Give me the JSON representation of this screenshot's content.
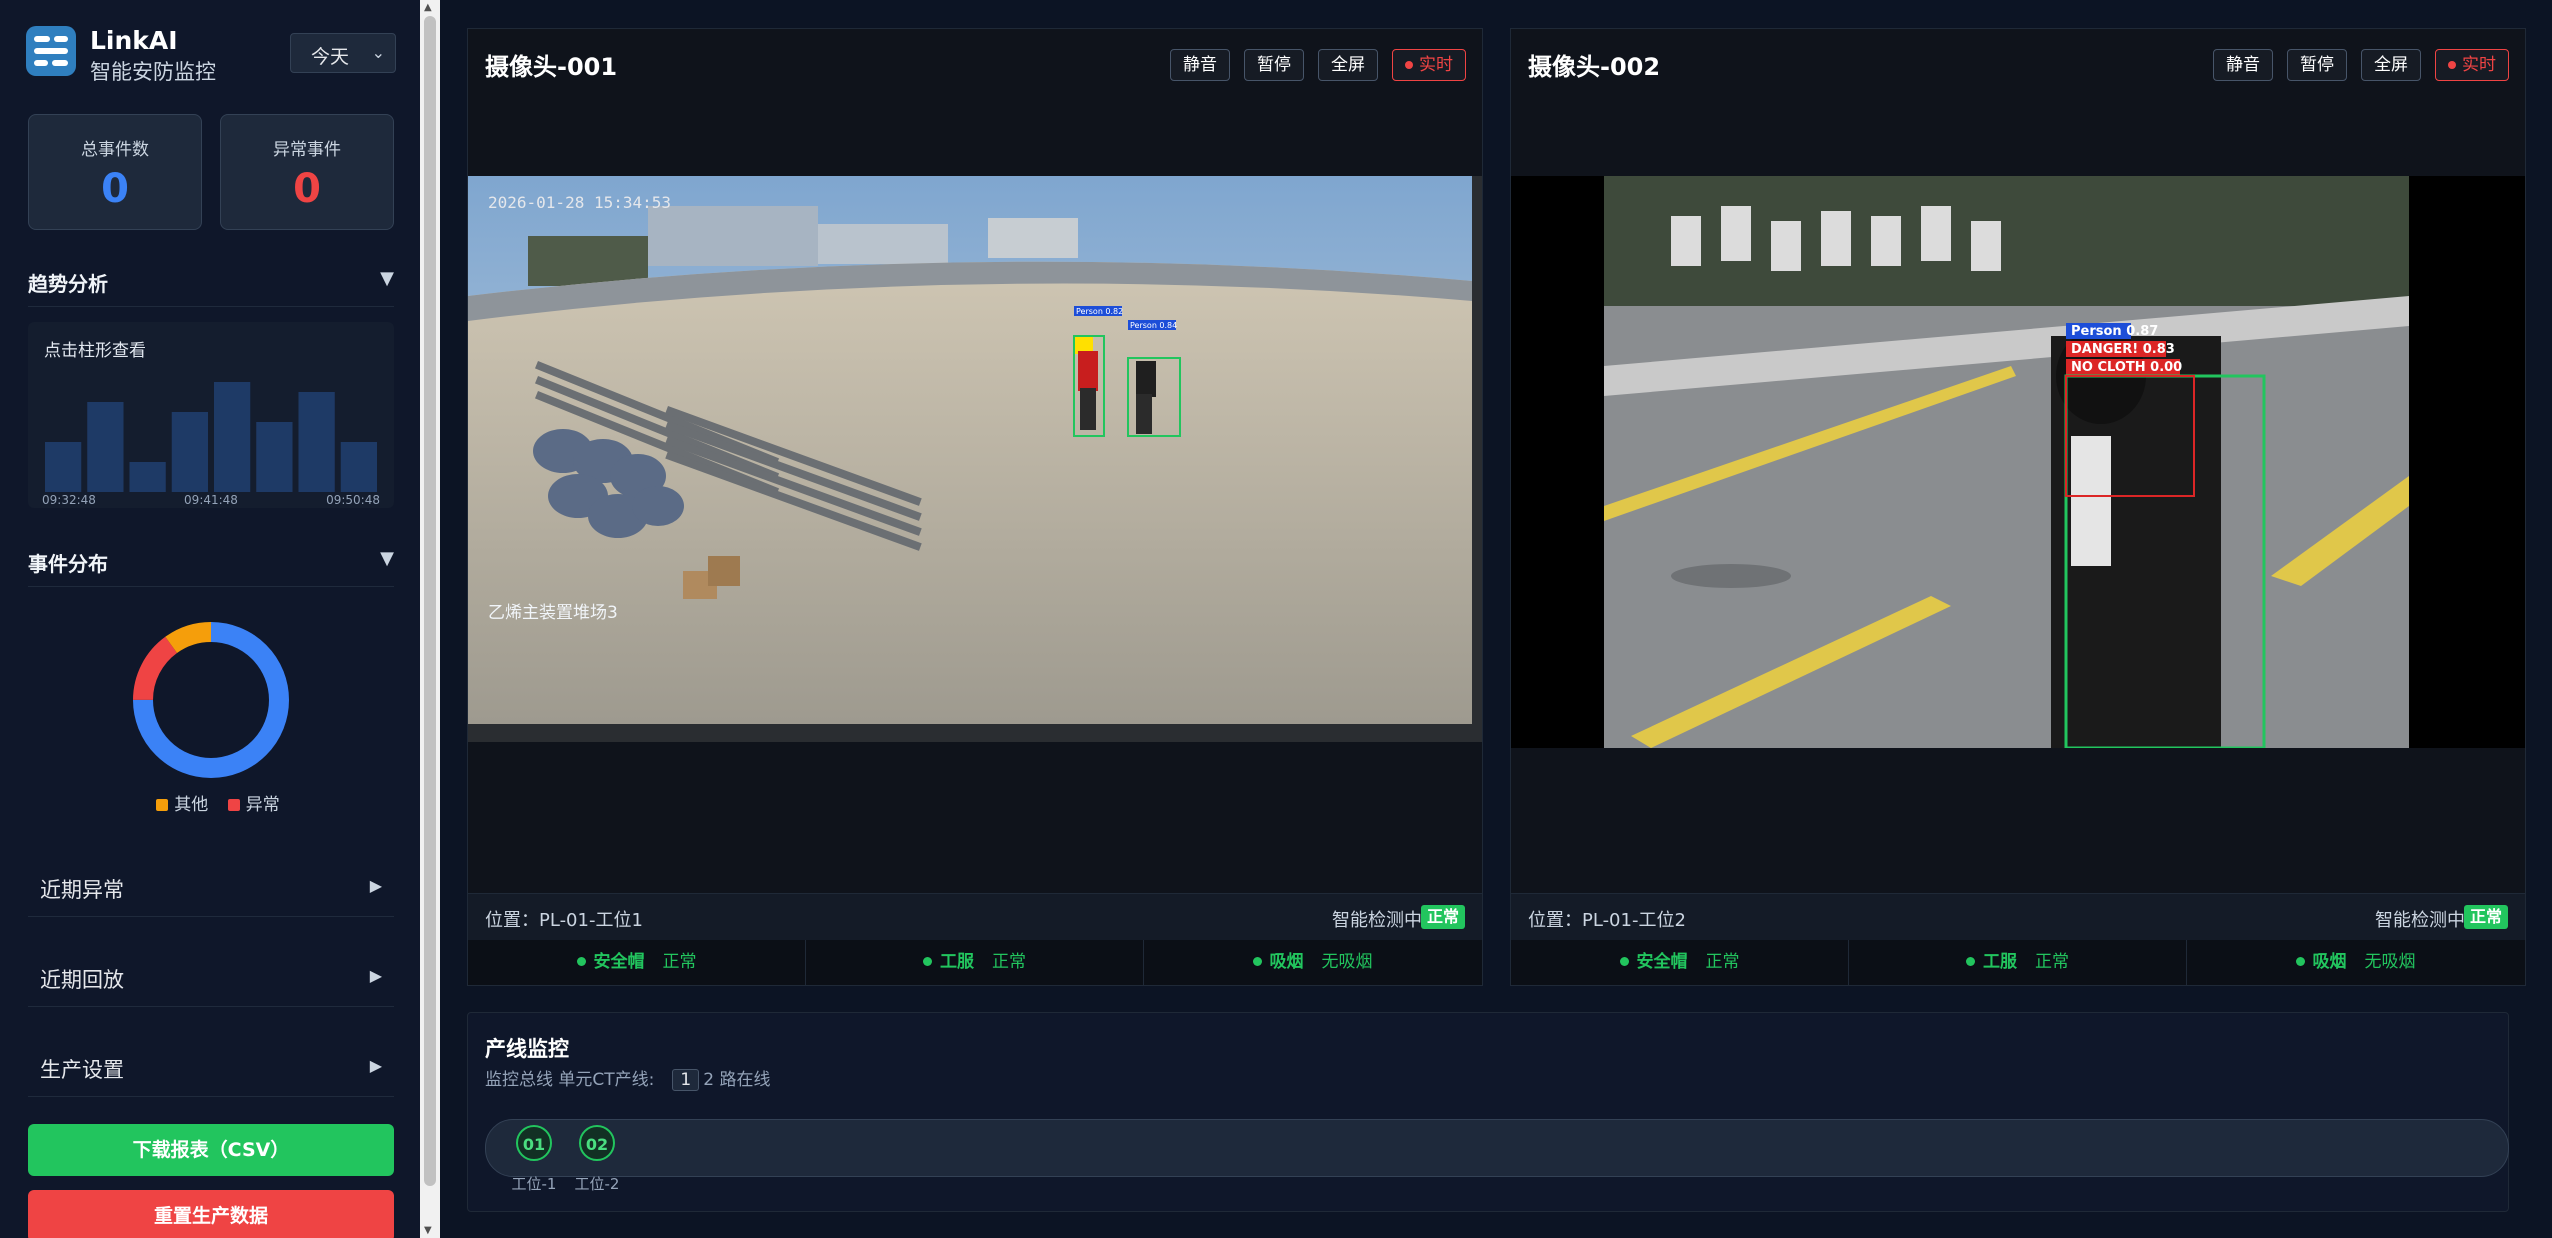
{
  "brand": {
    "name": "LinkAI",
    "subtitle": "智能安防监控"
  },
  "range_select": {
    "value": "今天"
  },
  "stats": {
    "total": {
      "label": "总事件数",
      "value": "0",
      "color": "#3b82f6"
    },
    "abnormal": {
      "label": "异常事件",
      "value": "0",
      "color": "#ef4444"
    }
  },
  "trend": {
    "title": "趋势分析",
    "hint": "点击柱形查看",
    "chart_data": {
      "type": "bar",
      "values": [
        5,
        9,
        3,
        8,
        11,
        7,
        10,
        5
      ],
      "x_tick_labels": [
        "09:32:48",
        "09:41:48",
        "09:50:48"
      ],
      "bar_color": "#1e3a66"
    }
  },
  "distribution": {
    "title": "事件分布",
    "chart_data": {
      "type": "pie",
      "slices": [
        {
          "name": "其他",
          "value": 75,
          "color": "#3b82f6"
        },
        {
          "name": "异常",
          "value": 15,
          "color": "#ef4444"
        },
        {
          "name": "其他",
          "value": 10,
          "color": "#f59e0b"
        }
      ]
    },
    "legend": [
      {
        "label": "其他",
        "color": "#f59e0b"
      },
      {
        "label": "异常",
        "color": "#ef4444"
      }
    ]
  },
  "accordion": [
    {
      "label": "近期异常"
    },
    {
      "label": "近期回放"
    },
    {
      "label": "生产设置"
    }
  ],
  "buttons": {
    "download": {
      "label": "下载报表（CSV）",
      "color": "#22c55e"
    },
    "reset": {
      "label": "重置生产数据",
      "color": "#ef4444"
    }
  },
  "camera_buttons": {
    "mute": "静音",
    "pause": "暂停",
    "fullscreen": "全屏",
    "live": "实时"
  },
  "cameras": [
    {
      "title": "摄像头-001",
      "timestamp": "2026-01-28 15:34:53",
      "scene_label": "乙烯主装置堆场3",
      "location": "位置：PL-01-工位1",
      "detect_text": "智能检测中",
      "status_badge": "正常",
      "detections": [
        "Person 0.82",
        "Person 0.84"
      ],
      "checks": [
        {
          "name": "安全帽",
          "value": "正常"
        },
        {
          "name": "工服",
          "value": "正常"
        },
        {
          "name": "吸烟",
          "value": "无吸烟"
        }
      ]
    },
    {
      "title": "摄像头-002",
      "location": "位置：PL-01-工位2",
      "detect_text": "智能检测中",
      "status_badge": "正常",
      "detections": [
        "Person 0.87",
        "DANGER! 0.83",
        "NO CLOTH 0.00"
      ],
      "checks": [
        {
          "name": "安全帽",
          "value": "正常"
        },
        {
          "name": "工服",
          "value": "正常"
        },
        {
          "name": "吸烟",
          "value": "无吸烟"
        }
      ]
    }
  ],
  "production_line": {
    "title": "产线监控",
    "subtitle_prefix": "监控总线 单元CT产线:",
    "count": "1",
    "online_text": "2 路在线",
    "stations": [
      {
        "id": "01",
        "name": "工位-1"
      },
      {
        "id": "02",
        "name": "工位-2"
      }
    ]
  }
}
